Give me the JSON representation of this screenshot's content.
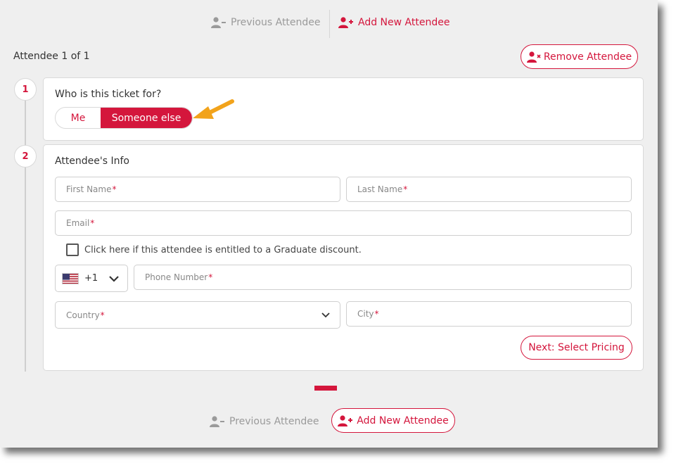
{
  "nav": {
    "previous_label": "Previous Attendee",
    "add_label": "Add New Attendee"
  },
  "attendee_count": "Attendee 1 of 1",
  "remove_label": "Remove Attendee",
  "steps": [
    "1",
    "2"
  ],
  "ticket_question": "Who is this ticket for?",
  "toggle": {
    "me_label": "Me",
    "someone_else_label": "Someone else",
    "selected": "Someone else"
  },
  "info": {
    "title": "Attendee's Info",
    "first_name_placeholder": "First Name",
    "last_name_placeholder": "Last Name",
    "email_placeholder": "Email",
    "required_marker": "*",
    "graduate_checkbox_label": "Click here if this attendee is entitled to a Graduate discount.",
    "dial_code": "+1",
    "phone_placeholder": "Phone Number",
    "country_placeholder": "Country",
    "city_placeholder": "City",
    "next_label": "Next: Select Pricing"
  },
  "colors": {
    "accent": "#d4163c",
    "arrow": "#f2a31b",
    "panel": "#efefef"
  },
  "icons": {
    "prev": "user-minus-icon",
    "add": "user-plus-icon",
    "remove": "user-x-icon",
    "flag": "us-flag-icon",
    "chevron": "chevron-down-icon",
    "annotation": "arrow-icon"
  }
}
